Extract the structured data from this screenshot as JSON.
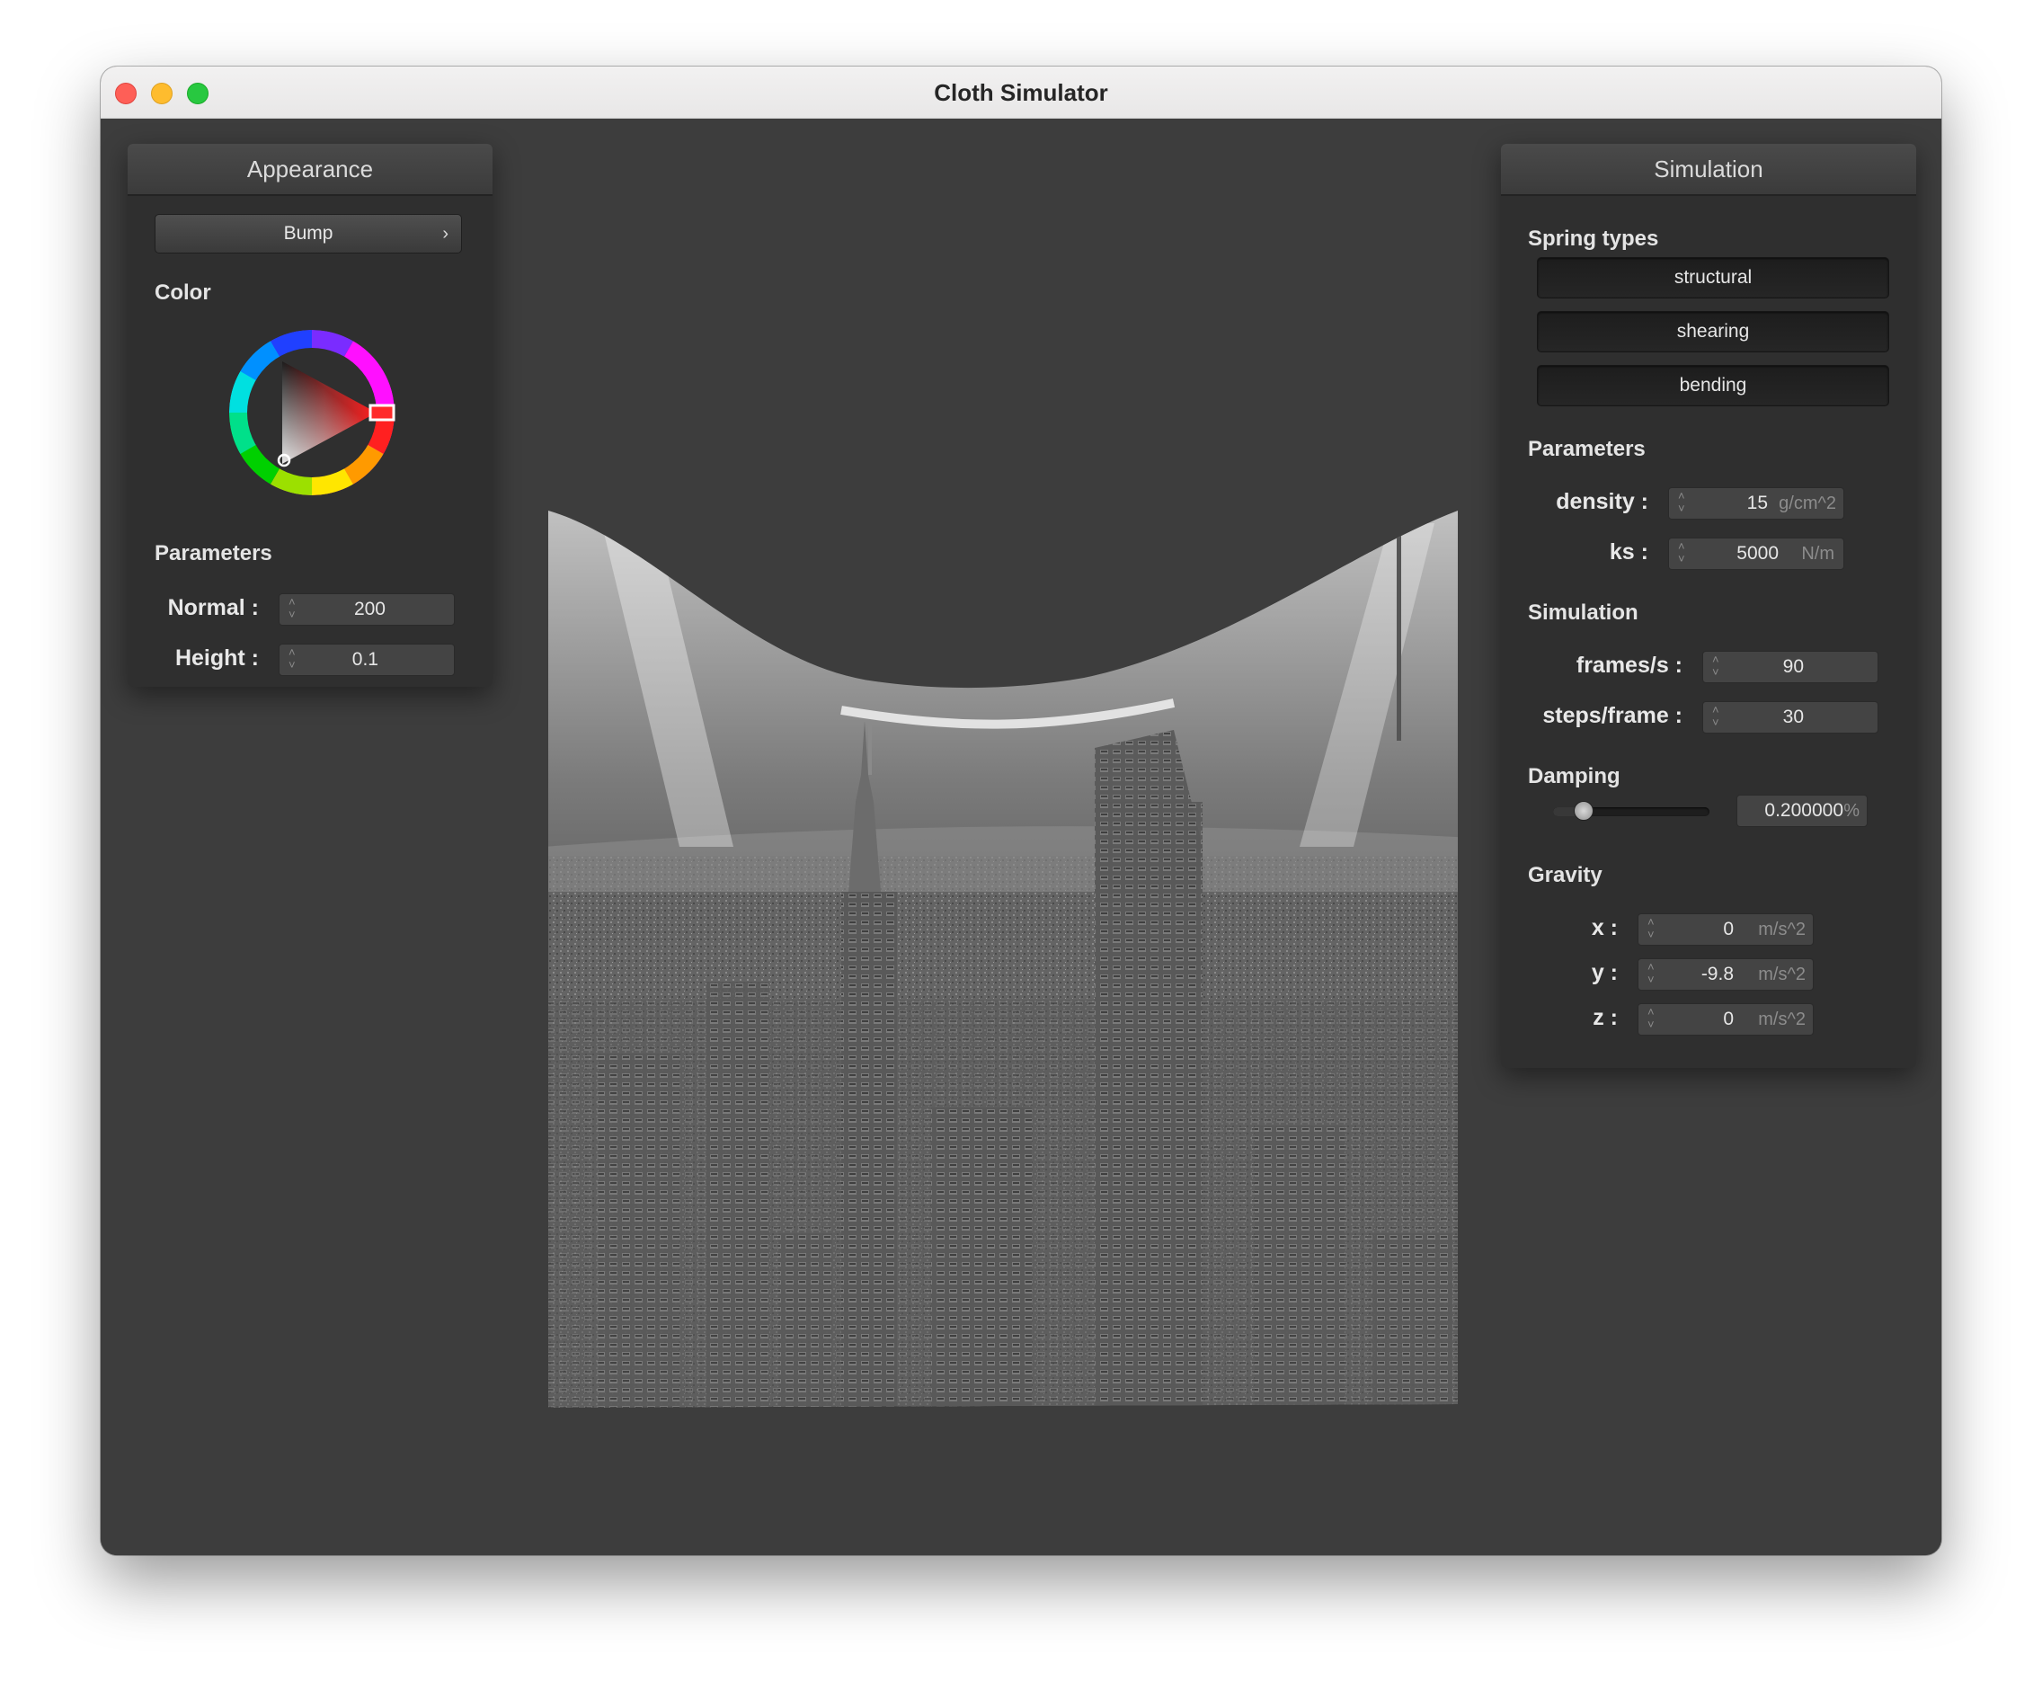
{
  "window": {
    "title": "Cloth Simulator"
  },
  "colors": {
    "panel_bg": "#2f2f2f",
    "viewport_bg": "#3d3d3d",
    "close": "#fe5f57",
    "minimize": "#febc2e",
    "maximize": "#28c840",
    "color_marker": "#ff2a2a"
  },
  "appearance": {
    "title": "Appearance",
    "shader_dropdown": {
      "value": "Bump",
      "arrow": "›"
    },
    "color_label": "Color",
    "parameters_label": "Parameters",
    "normal": {
      "label": "Normal :",
      "value": "200"
    },
    "height": {
      "label": "Height :",
      "value": "0.1"
    }
  },
  "simulation": {
    "title": "Simulation",
    "spring_types_label": "Spring types",
    "spring_types": [
      "structural",
      "shearing",
      "bending"
    ],
    "parameters_label": "Parameters",
    "density": {
      "label": "density :",
      "value": "15",
      "unit": "g/cm^2"
    },
    "ks": {
      "label": "ks :",
      "value": "5000",
      "unit": "N/m"
    },
    "simulation_label": "Simulation",
    "frames_per_s": {
      "label": "frames/s :",
      "value": "90"
    },
    "steps_per_frame": {
      "label": "steps/frame :",
      "value": "30"
    },
    "damping_label": "Damping",
    "damping": {
      "value": "0.200000",
      "unit": "%",
      "slider_fraction": 0.2
    },
    "gravity_label": "Gravity",
    "gravity": {
      "x": {
        "label": "x :",
        "value": "0",
        "unit": "m/s^2"
      },
      "y": {
        "label": "y :",
        "value": "-9.8",
        "unit": "m/s^2"
      },
      "z": {
        "label": "z :",
        "value": "0",
        "unit": "m/s^2"
      }
    }
  },
  "viewport": {
    "content": "bump-mapped cloth with city skyline texture"
  }
}
